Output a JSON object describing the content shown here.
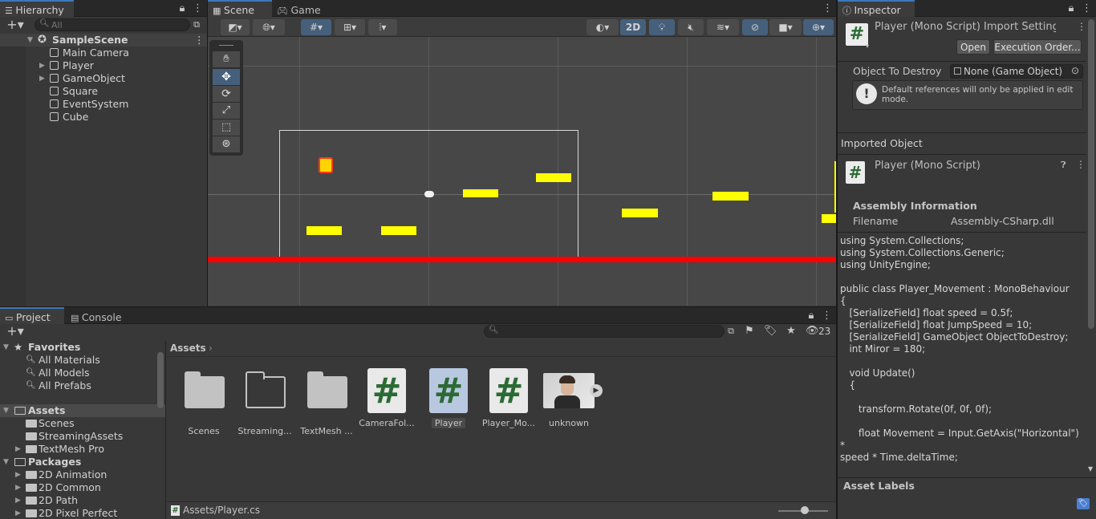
{
  "hierarchy": {
    "tab": "Hierarchy",
    "search_placeholder": "All",
    "scene_name": "SampleScene",
    "items": [
      {
        "label": "Main Camera",
        "expandable": false
      },
      {
        "label": "Player",
        "expandable": true
      },
      {
        "label": "GameObject",
        "expandable": true
      },
      {
        "label": "Square",
        "expandable": false
      },
      {
        "label": "EventSystem",
        "expandable": false
      },
      {
        "label": "Cube",
        "expandable": false
      }
    ]
  },
  "scene_view": {
    "tabs": [
      "Scene",
      "Game"
    ],
    "mode_2d": "2D",
    "tools": [
      "hand-tool",
      "move-tool",
      "rotate-tool",
      "scale-tool",
      "rect-tool",
      "transform-tool"
    ]
  },
  "project": {
    "tabs": [
      "Project",
      "Console"
    ],
    "hidden_count": "23",
    "favorites_label": "Favorites",
    "favorites": [
      "All Materials",
      "All Models",
      "All Prefabs"
    ],
    "assets_label": "Assets",
    "asset_folders": [
      "Scenes",
      "StreamingAssets",
      "TextMesh Pro"
    ],
    "packages_label": "Packages",
    "packages": [
      "2D Animation",
      "2D Common",
      "2D Path",
      "2D Pixel Perfect"
    ],
    "breadcrumb": "Assets",
    "grid_items": [
      {
        "label": "Scenes",
        "kind": "folder"
      },
      {
        "label": "Streaming...",
        "kind": "folder-open"
      },
      {
        "label": "TextMesh ...",
        "kind": "folder"
      },
      {
        "label": "CameraFol...",
        "kind": "script"
      },
      {
        "label": "Player",
        "kind": "script",
        "selected": true
      },
      {
        "label": "Player_Mo...",
        "kind": "script"
      },
      {
        "label": "unknown",
        "kind": "video"
      }
    ],
    "status_path": "Assets/Player.cs"
  },
  "inspector": {
    "tab": "Inspector",
    "title": "Player (Mono Script) Import Settings",
    "open_button": "Open",
    "exec_order_button": "Execution Order...",
    "field_label": "Object To Destroy",
    "field_value": "None (Game Object)",
    "help_text": "Default references will only be applied in edit mode.",
    "imported_object_label": "Imported Object",
    "imported_title": "Player (Mono Script)",
    "assembly_header": "Assembly Information",
    "filename_label": "Filename",
    "filename_value": "Assembly-CSharp.dll",
    "code": "using System.Collections;\nusing System.Collections.Generic;\nusing UnityEngine;\n\npublic class Player_Movement : MonoBehaviour\n{\n   [SerializeField] float speed = 0.5f;\n   [SerializeField] float JumpSpeed = 10;\n   [SerializeField] GameObject ObjectToDestroy;\n   int Miror = 180;\n\n   void Update()\n   {\n\n      transform.Rotate(0f, 0f, 0f);\n\n      float Movement = Input.GetAxis(\"Horizontal\") *\nspeed * Time.deltaTime;\n\n      //float JumpI = Input.GetAxis(\"jump\") *",
    "asset_labels": "Asset Labels"
  },
  "colors": {
    "accent": "#3a79bb",
    "platform": "#ffff00",
    "ground": "#ff0000",
    "player": "#ffd400"
  }
}
